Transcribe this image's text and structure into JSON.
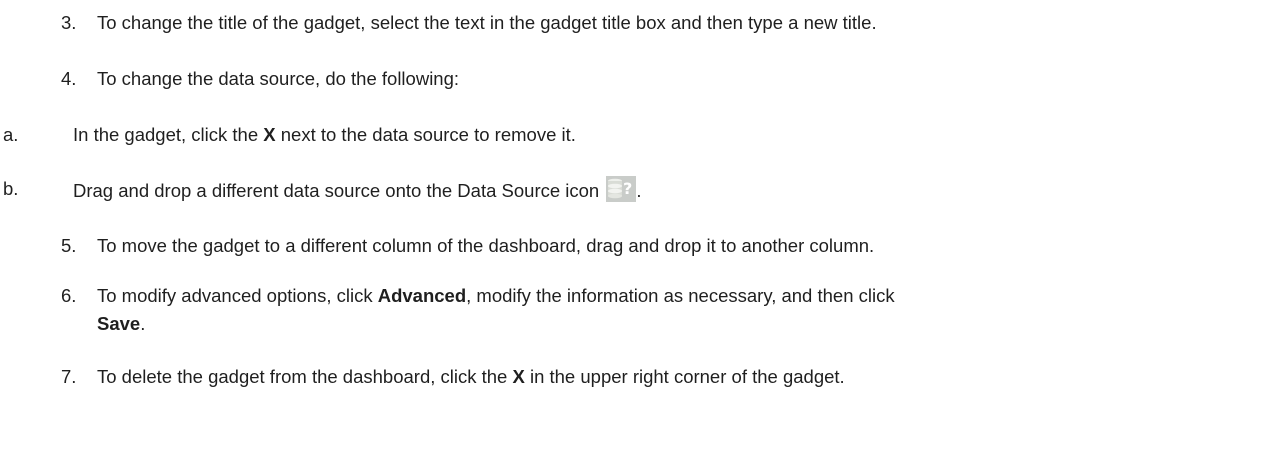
{
  "steps": [
    {
      "num": "3.",
      "text": "To change the title of the gadget, select the text in the gadget title box and then type a new title."
    },
    {
      "num": "4.",
      "text": "To change the data source, do the following:"
    }
  ],
  "substeps": [
    {
      "num": "a.",
      "pre": "In the gadget, click the ",
      "bold": "X",
      "post": " next to the data source to remove it."
    },
    {
      "num": "b.",
      "pre": "Drag and drop a different data source onto the Data Source icon ",
      "post": ".",
      "icon": "database-question-icon"
    }
  ],
  "steps2": [
    {
      "num": "5.",
      "text": "To move the gadget to a different column of the dashboard, drag and drop it to another column."
    },
    {
      "num": "6.",
      "pre": "To modify advanced options, click ",
      "bold1": "Advanced",
      "mid": ", modify the information as necessary, and then click",
      "bold2": "Save",
      "post": "."
    },
    {
      "num": "7.",
      "pre": "To delete the gadget from the dashboard, click the ",
      "bold": "X",
      "post": " in the upper right corner of the gadget."
    }
  ]
}
